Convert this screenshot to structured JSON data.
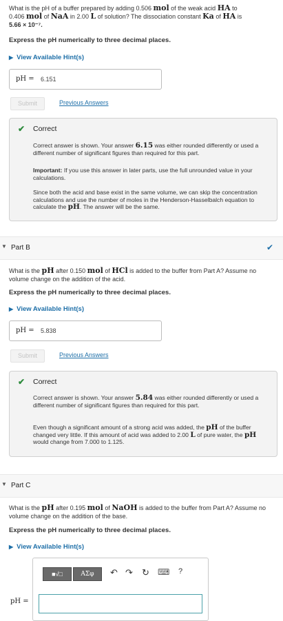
{
  "partA": {
    "question_lines": [
      [
        "What is the pH of a buffer prepared by adding 0.506 ",
        "mol",
        " of the weak acid ",
        "HA",
        " to"
      ],
      [
        "0.406 ",
        "mol",
        " of ",
        "NaA",
        " in 2.00 ",
        "L",
        " of solution? The dissociation constant ",
        "Ka",
        " of ",
        "HA",
        " is"
      ],
      [
        "5.66 × 10⁻⁷."
      ]
    ],
    "instruction": "Express the pH numerically to three decimal places.",
    "hint_label": "View Available Hint(s)",
    "ph_label": "pH =",
    "answer": "6.151",
    "submit_label": "Submit",
    "previous_label": "Previous Answers",
    "feedback": {
      "title": "Correct",
      "p1_pre": "Correct answer is shown. Your answer ",
      "p1_val": "6.15",
      "p1_post": " was either rounded differently or used a different number of significant figures than required for this part.",
      "p2_strong": "Important:",
      "p2_text": " If you use this answer in later parts, use the full unrounded value in your calculations.",
      "p3_pre": "Since both the acid and base exist in the same volume, we can skip the concentration calculations and use the number of moles in the Henderson-Hasselbalch equation to calculate the ",
      "p3_m": "pH",
      "p3_post": ". The answer will be the same."
    }
  },
  "partB": {
    "title": "Part B",
    "q_pre": "What is the ",
    "q_m1": "pH",
    "q_mid1": " after 0.150 ",
    "q_m2": "mol",
    "q_mid2": " of ",
    "q_m3": "HCl",
    "q_post": " is added to the buffer from Part A? Assume no volume change on the addition of the acid.",
    "instruction": "Express the pH numerically to three decimal places.",
    "hint_label": "View Available Hint(s)",
    "ph_label": "pH =",
    "answer": "5.838",
    "submit_label": "Submit",
    "previous_label": "Previous Answers",
    "feedback": {
      "title": "Correct",
      "p1_pre": "Correct answer is shown. Your answer ",
      "p1_val": "5.84",
      "p1_post": " was either rounded differently or used a different number of significant figures than required for this part.",
      "p2_a": "Even though a significant amount of a strong acid was added, the ",
      "p2_m1": "pH",
      "p2_b": " of the buffer changed very little. If this amount of acid was added to 2.00 ",
      "p2_m2": "L",
      "p2_c": " of pure water, the ",
      "p2_m3": "pH",
      "p2_d": " would change from 7.000 to 1.125."
    }
  },
  "partC": {
    "title": "Part C",
    "q_pre": "What is the ",
    "q_m1": "pH",
    "q_mid1": " after 0.195 ",
    "q_m2": "mol",
    "q_mid2": " of ",
    "q_m3": "NaOH",
    "q_post": " is added to the buffer from Part A? Assume no volume change on the addition of the base.",
    "instruction": "Express the pH numerically to three decimal places.",
    "hint_label": "View Available Hint(s)",
    "ph_label": "pH =",
    "answer": "",
    "toolbar": {
      "templates_label": "■√□",
      "symbols_label": "ΑΣφ",
      "undo_icon": "↶",
      "redo_icon": "↷",
      "reset_icon": "↻",
      "keyboard_icon": "⌨",
      "help_label": "?"
    }
  }
}
